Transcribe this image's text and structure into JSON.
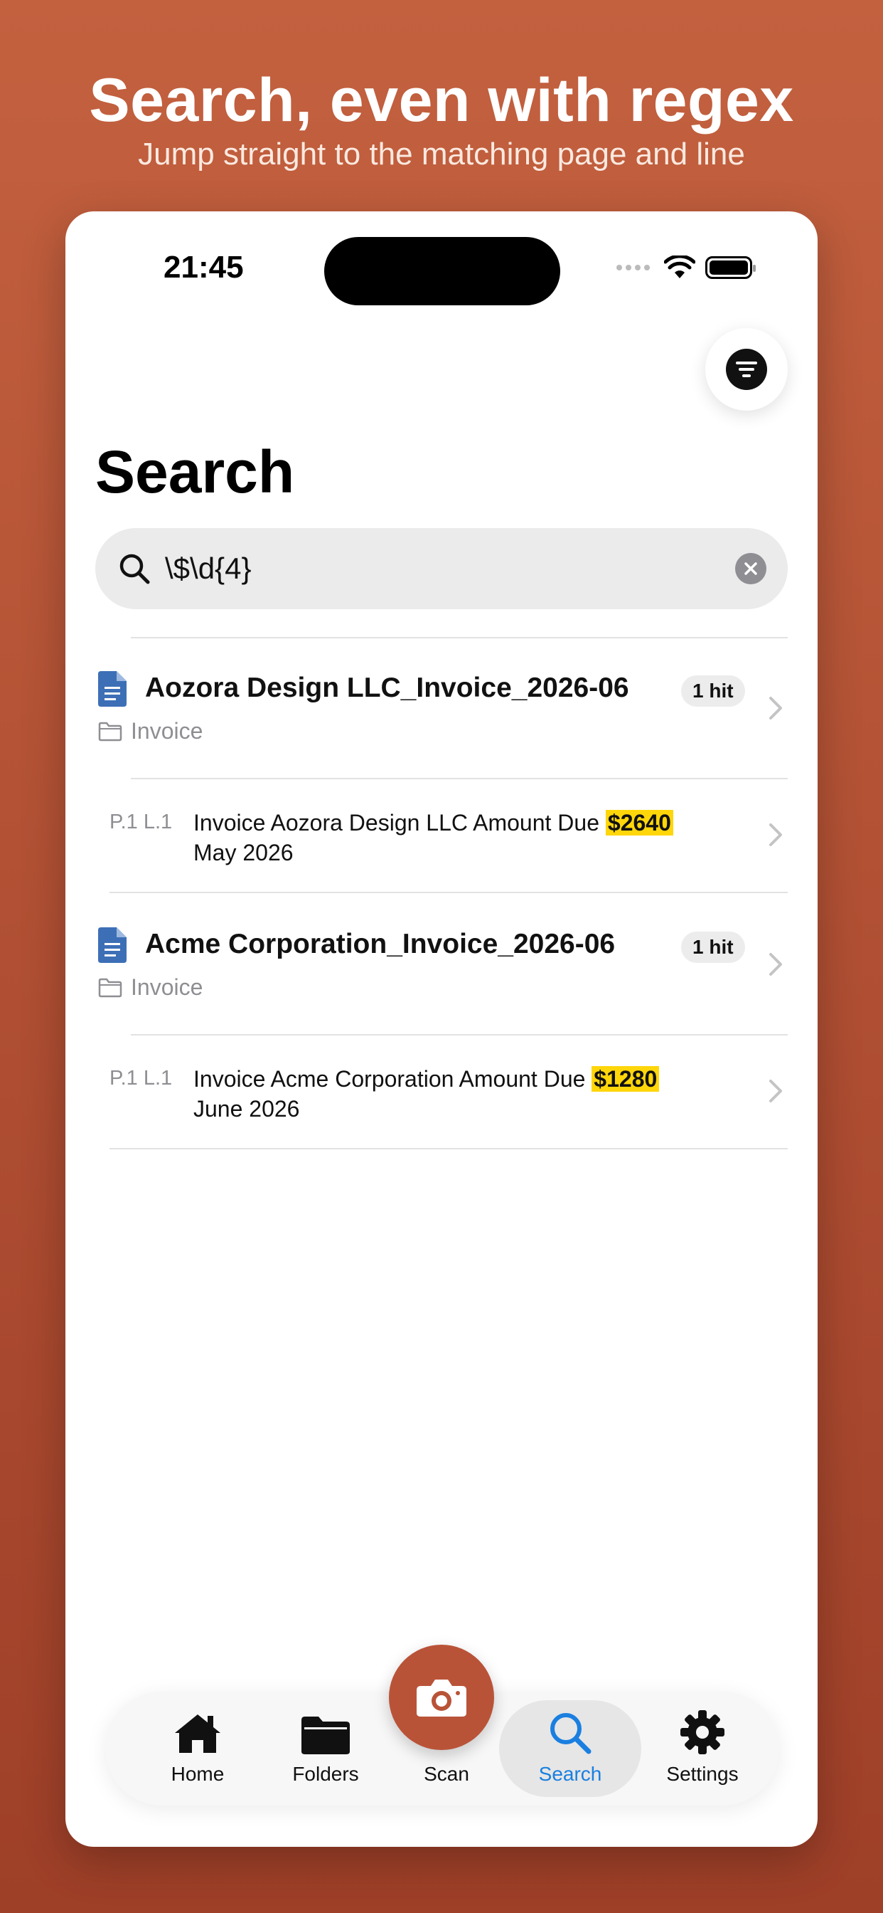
{
  "promo": {
    "title": "Search, even with regex",
    "subtitle": "Jump straight to the matching page and line"
  },
  "status_bar": {
    "time": "21:45"
  },
  "page": {
    "title": "Search"
  },
  "search": {
    "query": "\\$\\d{4}"
  },
  "results": [
    {
      "document": "Aozora Design LLC_Invoice_2026-06",
      "folder": "Invoice",
      "hits": "1 hit",
      "match": {
        "location": "P.1 L.1",
        "before": "Invoice Aozora Design LLC Amount Due ",
        "highlight": "$2640",
        "after": "May 2026"
      }
    },
    {
      "document": "Acme Corporation_Invoice_2026-06",
      "folder": "Invoice",
      "hits": "1 hit",
      "match": {
        "location": "P.1 L.1",
        "before": "Invoice Acme Corporation Amount Due ",
        "highlight": "$1280",
        "after": "June 2026"
      }
    }
  ],
  "tabbar": {
    "home": "Home",
    "folders": "Folders",
    "scan": "Scan",
    "search": "Search",
    "settings": "Settings",
    "active": "search"
  },
  "colors": {
    "accent": "#b95338",
    "active_tab": "#1a7fe0",
    "highlight": "#ffd60a",
    "doc_icon": "#3d6fb6"
  }
}
